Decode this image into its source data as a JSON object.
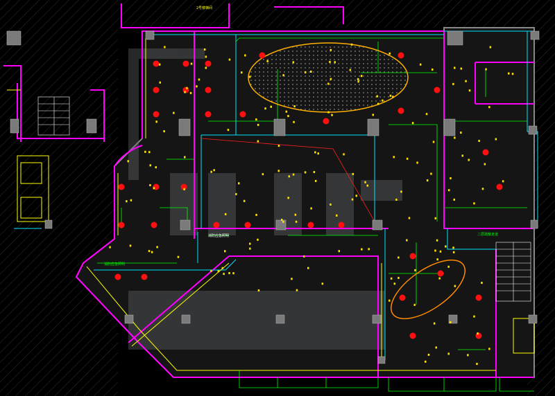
{
  "drawing": {
    "background": "#000000",
    "title_block_label": "",
    "annotations": [
      {
        "name": "room-label-top",
        "text": "2号楼梯间"
      },
      {
        "name": "room-label-right",
        "text": "二层疏散走道"
      },
      {
        "name": "leader-label-left",
        "text": "消防应急照明"
      },
      {
        "name": "leader-label-center",
        "text": "消防应急照明"
      }
    ]
  },
  "colors": {
    "wall_magenta": "#ff00ff",
    "wall_gray": "#8a8a8a",
    "hatch_gray": "#3a3a3a",
    "line_cyan": "#00e5ff",
    "line_green": "#00ff00",
    "line_yellow": "#ffff00",
    "line_orange": "#ffb000",
    "line_red": "#ff0000",
    "line_white": "#ffffff",
    "line_blue": "#3060ff",
    "fixture_red": "#ff1010",
    "fixture_yellow": "#ffe000",
    "column_gray": "#7a7a7a",
    "watermark": "#9aa0a6"
  },
  "symbols": {
    "downlight_red": "red circular ceiling downlight",
    "fixture_yellow": "yellow small ceiling fixture",
    "ellipse_feature": "elliptical ceiling feature",
    "column": "structural column"
  },
  "watermark": {
    "text": "",
    "visible": true
  }
}
